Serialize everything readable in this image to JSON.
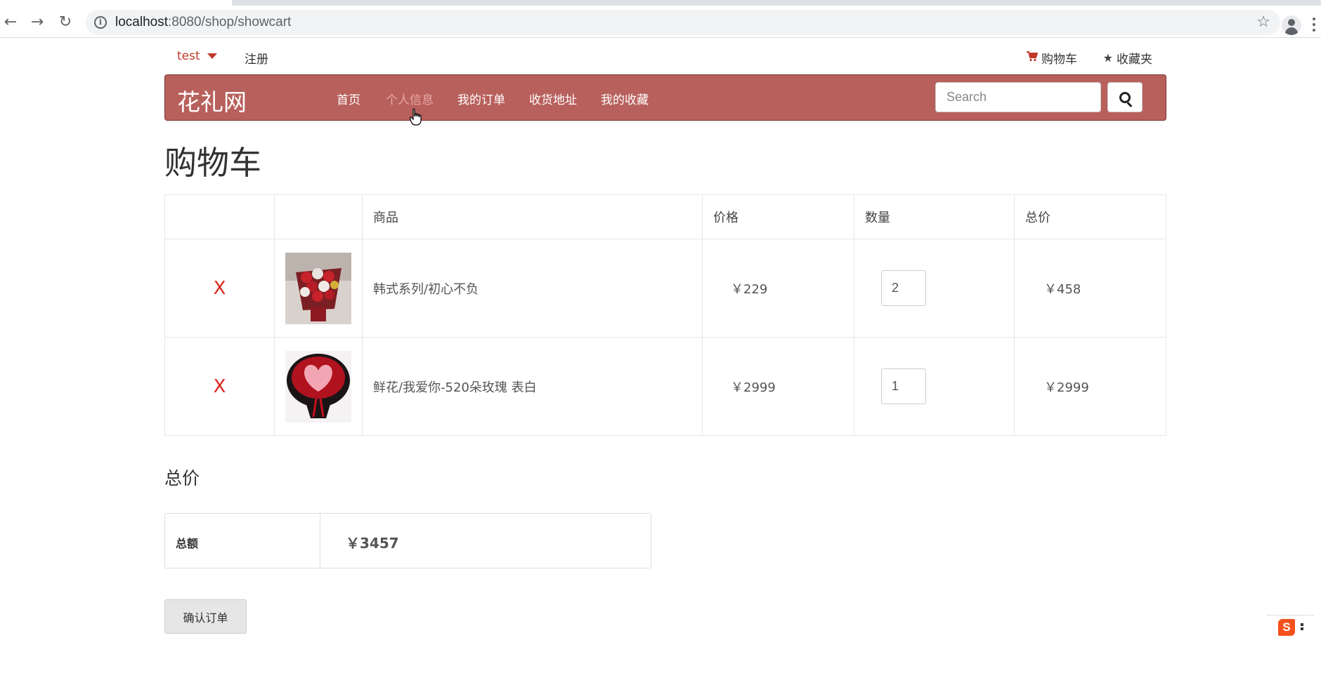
{
  "browser": {
    "url_host": "localhost",
    "url_path": ":8080/shop/showcart"
  },
  "topbar": {
    "user": "test",
    "register": "注册",
    "cart": "购物车",
    "favorites": "收藏夹"
  },
  "navbar": {
    "brand": "花礼网",
    "items": [
      "首页",
      "个人信息",
      "我的订单",
      "收货地址",
      "我的收藏"
    ],
    "active_item": "个人信息",
    "search_placeholder": "Search"
  },
  "page": {
    "title": "购物车"
  },
  "cart": {
    "headers": [
      "",
      "",
      "商品",
      "价格",
      "数量",
      "总价"
    ],
    "rows": [
      {
        "remove": "X",
        "name": "韩式系列/初心不负",
        "price": "￥229",
        "quantity": "2",
        "subtotal": "￥458"
      },
      {
        "remove": "X",
        "name": "鲜花/我爱你-520朵玫瑰 表白",
        "price": "￥2999",
        "quantity": "1",
        "subtotal": "￥2999"
      }
    ]
  },
  "summary": {
    "heading": "总价",
    "label": "总额",
    "total": "￥3457"
  },
  "actions": {
    "confirm": "确认订单"
  },
  "colors": {
    "navbar_bg": "#b8605c",
    "accent_red": "#d9261c"
  }
}
